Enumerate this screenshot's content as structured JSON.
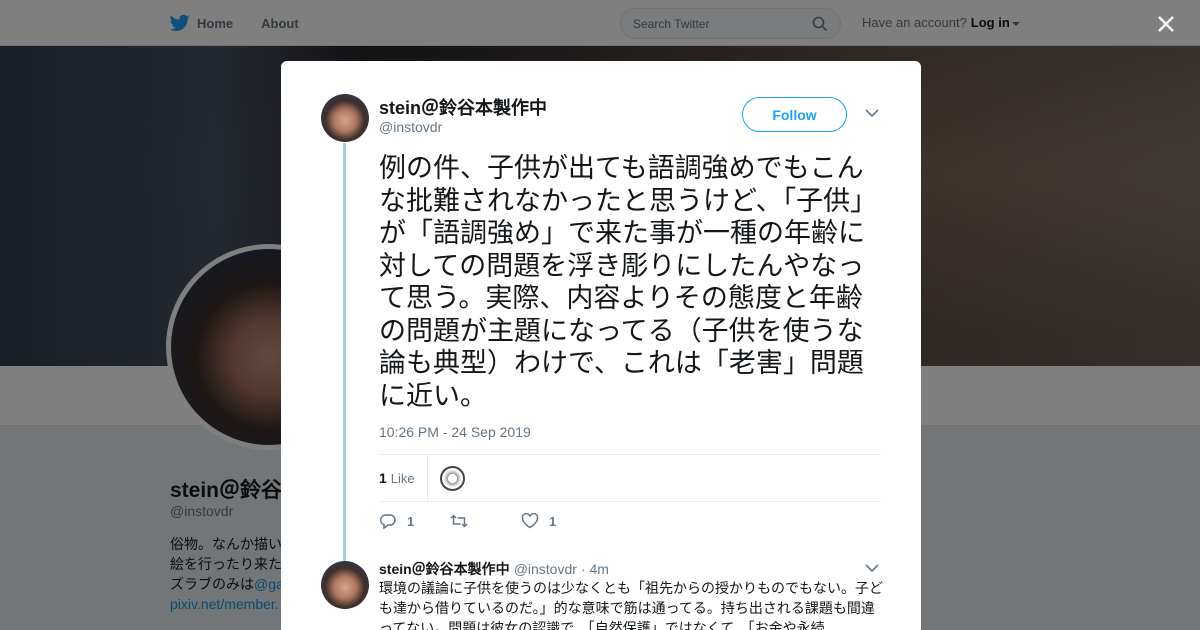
{
  "topbar": {
    "home_label": "Home",
    "about_label": "About",
    "search_placeholder": "Search Twitter",
    "account_prompt": "Have an account?",
    "login_label": "Log in",
    "brand_color": "#1da1f2"
  },
  "profile": {
    "name": "stein＠鈴谷本製作中",
    "handle": "@instovdr",
    "bio_line1": "俗物。なんか描い",
    "bio_line2": "絵を行ったり来た",
    "bio_line3_prefix": "ズラブのみは",
    "bio_line3_link": "@ga",
    "bio_line4": "pixiv.net/member."
  },
  "tweet": {
    "author_name": "stein＠鈴谷本製作中",
    "author_handle": "@instovdr",
    "follow_label": "Follow",
    "text": "例の件、子供が出ても語調強めでもこんな批難されなかったと思うけど、「子供」が「語調強め」で来た事が一種の年齢に対しての問題を浮き彫りにしたんやなって思う。実際、内容よりその態度と年齢の問題が主題になってる（子供を使うな論も典型）わけで、これは「老害」問題に近い。",
    "timestamp": "10:26 PM - 24 Sep 2019",
    "like_count": "1",
    "like_label": "Like",
    "reply_count": "1",
    "retweet_count": "",
    "heart_count": "1"
  },
  "reply": {
    "author_name": "stein＠鈴谷本製作中",
    "author_handle": "@instovdr",
    "age": "· 4m",
    "text": "環境の議論に子供を使うのは少なくとも「祖先からの授かりものでもない。子ども達から借りているのだ。」的な意味で筋は通ってる。持ち出される課題も間違ってない。問題は彼女の認識で、「自然保護」ではなくて、「お金や永続"
  }
}
